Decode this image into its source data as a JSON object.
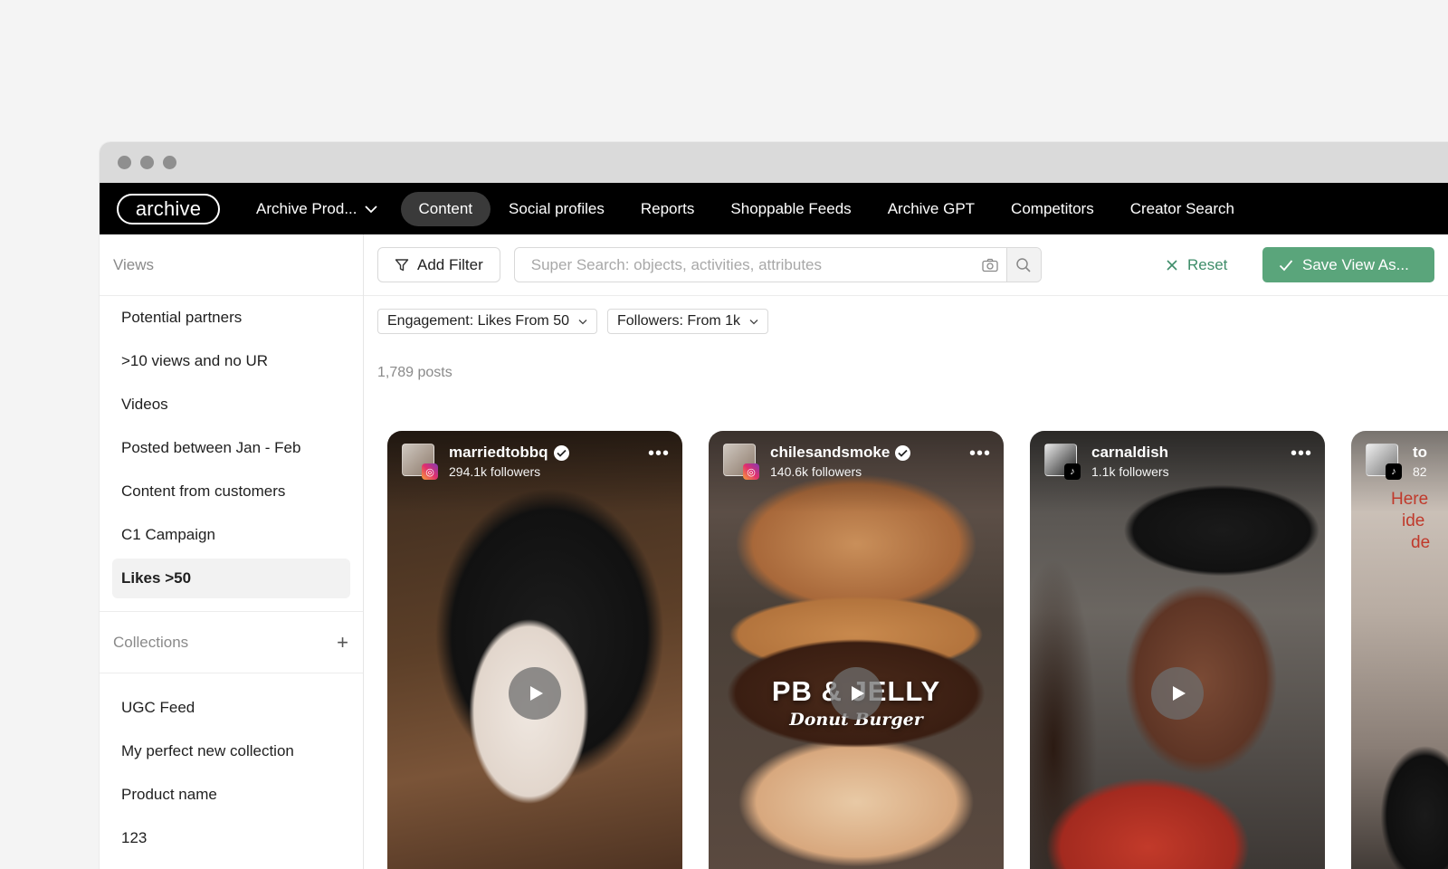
{
  "brand": {
    "logo_text": "archive"
  },
  "nav": {
    "org_label": "Archive Prod...",
    "items": [
      "Content",
      "Social profiles",
      "Reports",
      "Shoppable Feeds",
      "Archive GPT",
      "Competitors",
      "Creator Search"
    ],
    "active": "Content"
  },
  "sidebar": {
    "views_title": "Views",
    "views": [
      "Potential partners",
      ">10 views and no UR",
      "Videos",
      "Posted between Jan - Feb",
      "Content from customers",
      "C1 Campaign",
      "Likes >50"
    ],
    "active_view": "Likes >50",
    "collections_title": "Collections",
    "collections": [
      "UGC Feed",
      "My perfect new collection",
      "Product name",
      "123"
    ]
  },
  "toolbar": {
    "add_filter_label": "Add Filter",
    "search_placeholder": "Super Search: objects, activities, attributes",
    "reset_label": "Reset",
    "save_label": "Save View As..."
  },
  "filters": {
    "chips": [
      "Engagement: Likes From 50",
      "Followers: From 1k"
    ]
  },
  "results": {
    "count_text": "1,789 posts"
  },
  "posts": [
    {
      "handle": "marriedtobbq",
      "followers": "294.1k followers",
      "platform": "instagram",
      "verified": true
    },
    {
      "handle": "chilesandsmoke",
      "followers": "140.6k followers",
      "platform": "instagram",
      "verified": true,
      "overlay_title": "PB & JELLY",
      "overlay_sub": "Donut Burger"
    },
    {
      "handle": "carnaldish",
      "followers": "1.1k followers",
      "platform": "tiktok",
      "verified": false
    },
    {
      "handle": "to",
      "followers": "82",
      "platform": "tiktok",
      "verified": false,
      "overlay_text_lines": [
        "Here",
        "ide",
        "de"
      ]
    }
  ],
  "colors": {
    "accent_green": "#5aa57b",
    "reset_green": "#3f8d6a",
    "nav_bg": "#000000"
  }
}
